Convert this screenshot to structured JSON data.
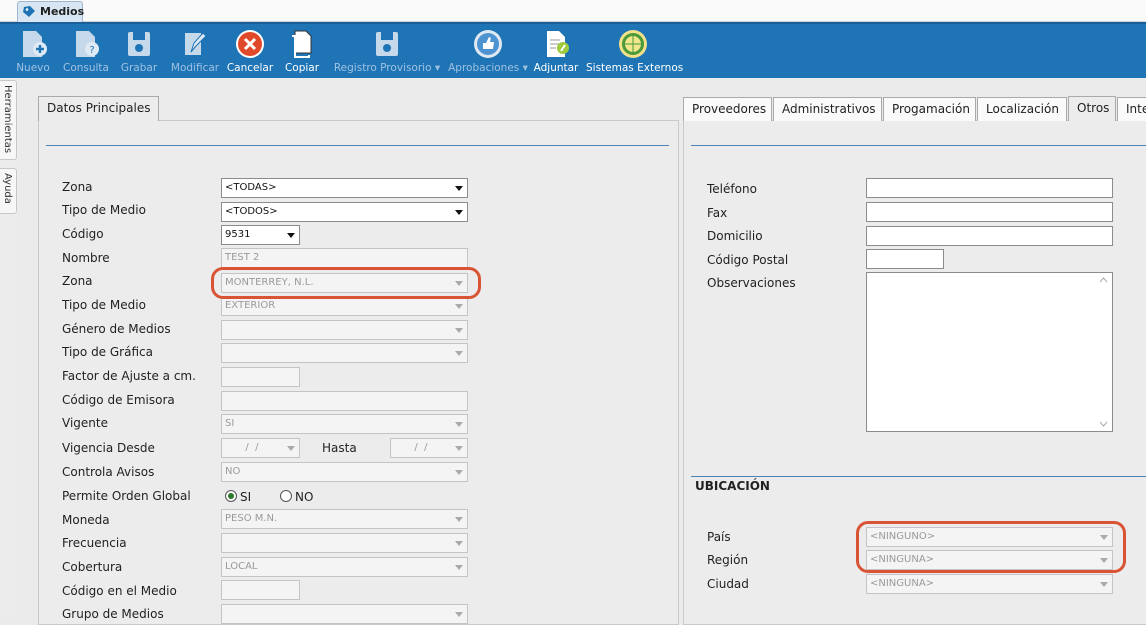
{
  "document_tab": {
    "label": "Medios"
  },
  "toolbar": [
    {
      "label": "Nuevo",
      "icon": "new-doc-icon",
      "enabled": false
    },
    {
      "label": "Consulta",
      "icon": "query-doc-icon",
      "enabled": false
    },
    {
      "label": "Grabar",
      "icon": "save-icon",
      "enabled": false
    },
    {
      "label": "Modificar",
      "icon": "edit-icon",
      "enabled": false
    },
    {
      "label": "Cancelar",
      "icon": "cancel-icon",
      "enabled": true
    },
    {
      "label": "Copiar",
      "icon": "copy-icon",
      "enabled": true
    },
    {
      "label": "Registro Provisorio ▾",
      "icon": "save-draft-icon",
      "enabled": false
    },
    {
      "label": "Aprobaciones ▾",
      "icon": "approve-icon",
      "enabled": false
    },
    {
      "label": "Adjuntar",
      "icon": "attach-icon",
      "enabled": true
    },
    {
      "label": "Sistemas Externos",
      "icon": "globe-icon",
      "enabled": true
    }
  ],
  "side_tabs": [
    "Herramientas",
    "Ayuda"
  ],
  "left": {
    "tab": "Datos Principales",
    "fields": {
      "zona_filtro": {
        "label": "Zona",
        "value": "<TODAS>"
      },
      "tipo_filtro": {
        "label": "Tipo de Medio",
        "value": "<TODOS>"
      },
      "codigo": {
        "label": "Código",
        "value": "9531"
      },
      "nombre": {
        "label": "Nombre",
        "value": "TEST 2"
      },
      "zona": {
        "label": "Zona",
        "value": "MONTERREY, N.L."
      },
      "tipo_medio": {
        "label": "Tipo de Medio",
        "value": "EXTERIOR"
      },
      "genero": {
        "label": "Género de Medios",
        "value": ""
      },
      "tipo_grafica": {
        "label": "Tipo de Gráfica",
        "value": ""
      },
      "factor": {
        "label": "Factor de Ajuste a cm.",
        "value": ""
      },
      "emisora": {
        "label": "Código de Emisora",
        "value": ""
      },
      "vigente": {
        "label": "Vigente",
        "value": "SI"
      },
      "vig_desde": {
        "label": "Vigencia Desde",
        "value": "  /  /"
      },
      "hasta": {
        "label": "Hasta",
        "value": "  /  /"
      },
      "controla": {
        "label": "Controla Avisos",
        "value": "NO"
      },
      "orden_global": {
        "label": "Permite Orden Global",
        "opt_si": "SI",
        "opt_no": "NO",
        "selected": "SI"
      },
      "moneda": {
        "label": "Moneda",
        "value": "PESO M.N."
      },
      "frecuencia": {
        "label": "Frecuencia",
        "value": ""
      },
      "cobertura": {
        "label": "Cobertura",
        "value": "LOCAL"
      },
      "codigo_medio": {
        "label": "Código en el Medio",
        "value": ""
      },
      "grupo": {
        "label": "Grupo de Medios",
        "value": ""
      }
    }
  },
  "right": {
    "tabs": [
      "Proveedores",
      "Administrativos",
      "Progamación",
      "Localización",
      "Otros",
      "Inte"
    ],
    "active_tab": "Otros",
    "fields": {
      "telefono": {
        "label": "Teléfono",
        "value": ""
      },
      "fax": {
        "label": "Fax",
        "value": ""
      },
      "domicilio": {
        "label": "Domicilio",
        "value": ""
      },
      "cp": {
        "label": "Código Postal",
        "value": ""
      },
      "observaciones": {
        "label": "Observaciones",
        "value": ""
      }
    },
    "ubicacion": {
      "title": "UBICACIÓN",
      "pais": {
        "label": "País",
        "value": "<NINGUNO>"
      },
      "region": {
        "label": "Región",
        "value": "<NINGUNA>"
      },
      "ciudad": {
        "label": "Ciudad",
        "value": "<NINGUNA>"
      }
    }
  },
  "highlight_color": "#d95434"
}
